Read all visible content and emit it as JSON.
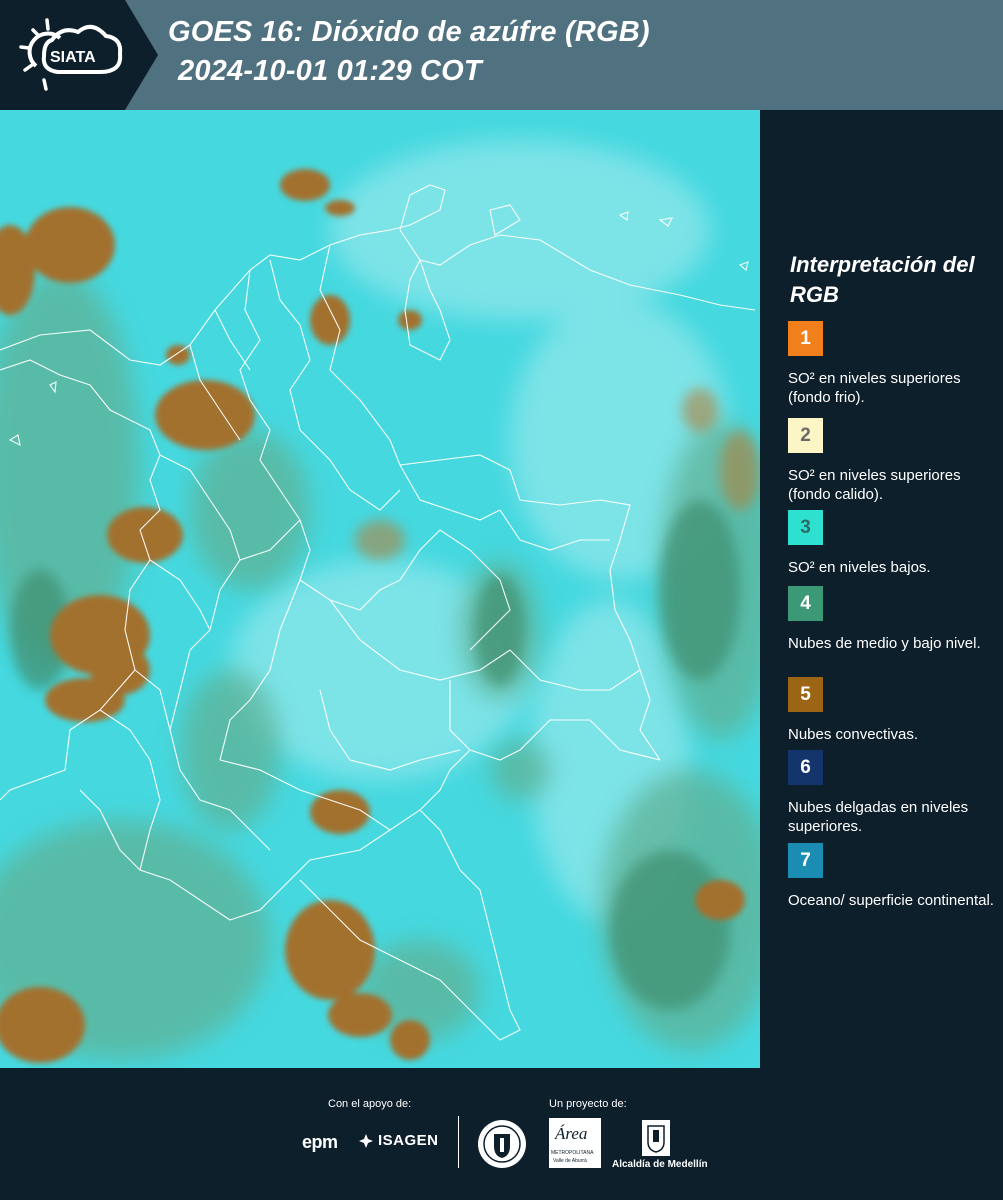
{
  "header": {
    "brand": "SIATA",
    "title_line1": "GOES 16: Dióxido de azúfre (RGB)",
    "title_line2": "2024-10-01 01:29 COT",
    "accent": "#50717f"
  },
  "map": {
    "description_colors": {
      "background": "#3fd5dc",
      "convective": "#9c6f2b",
      "mid_low": "#5aa888",
      "border": "#ffffff"
    }
  },
  "legend": {
    "title": "Interpretación del RGB",
    "items": [
      {
        "number": "1",
        "color": "#f07f1c",
        "text": "SO² en niveles superiores (fondo frio)."
      },
      {
        "number": "2",
        "color": "#fcf5c5",
        "text": "SO² en niveles superiores (fondo calido)."
      },
      {
        "number": "3",
        "color": "#2de0cf",
        "text": "SO² en niveles bajos."
      },
      {
        "number": "4",
        "color": "#3b9a75",
        "text": "Nubes de medio y bajo nivel."
      },
      {
        "number": "5",
        "color": "#9c6415",
        "text": "Nubes convectivas."
      },
      {
        "number": "6",
        "color": "#14356b",
        "text": "Nubes delgadas en niveles superiores."
      },
      {
        "number": "7",
        "color": "#1b8db3",
        "text": "Oceano/ superficie continental."
      }
    ]
  },
  "footer": {
    "support_label": "Con el apoyo de:",
    "project_label": "Un proyecto de:",
    "sponsors": [
      "epm",
      "ISAGEN"
    ],
    "partners": [
      "Área Metropolitana Valle de Aburrá",
      "Alcaldía de Medellín"
    ],
    "epm_text": "epm",
    "isagen_text": "ISAGEN",
    "area_text": "Área",
    "area_sub": "METROPOLITANA",
    "area_sub2": "Valle de Aburrá",
    "alcaldia_text": "Alcaldía de Medellín"
  }
}
